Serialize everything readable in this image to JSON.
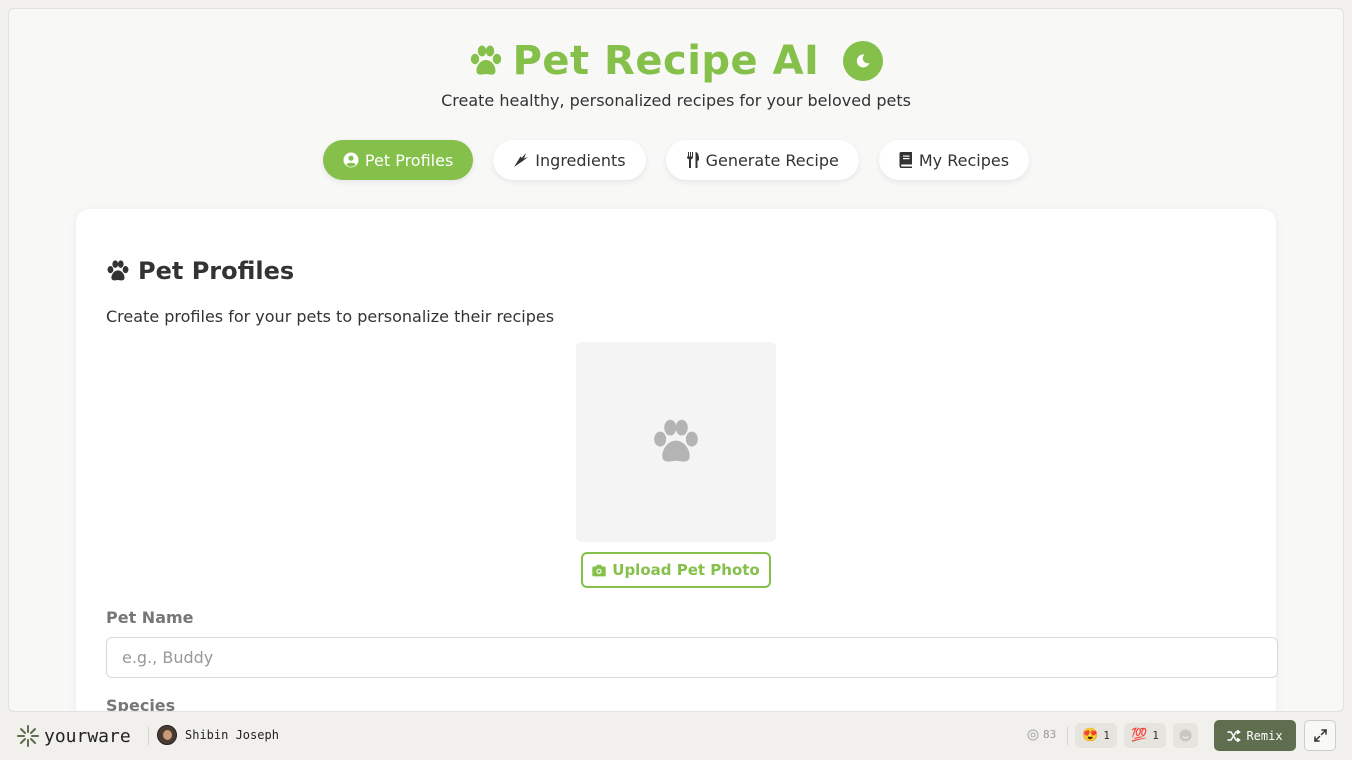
{
  "app": {
    "title": "Pet Recipe AI",
    "subtitle": "Create healthy, personalized recipes for your beloved pets",
    "accent_color": "#84c04a"
  },
  "tabs": [
    {
      "label": "Pet Profiles",
      "icon": "user-circle-icon",
      "active": true
    },
    {
      "label": "Ingredients",
      "icon": "carrot-icon",
      "active": false
    },
    {
      "label": "Generate Recipe",
      "icon": "utensils-icon",
      "active": false
    },
    {
      "label": "My Recipes",
      "icon": "book-icon",
      "active": false
    }
  ],
  "panel": {
    "title": "Pet Profiles",
    "description": "Create profiles for your pets to personalize their recipes",
    "photo_icon": "paw-icon",
    "upload_label": "Upload Pet Photo",
    "fields": {
      "pet_name_label": "Pet Name",
      "pet_name_placeholder": "e.g., Buddy",
      "pet_name_value": "",
      "species_label": "Species"
    }
  },
  "footer": {
    "brand": "yourware",
    "user_name": "Shibin Joseph",
    "views": "83",
    "reactions": [
      {
        "emoji": "😍",
        "count": "1"
      },
      {
        "emoji": "💯",
        "count": "1"
      }
    ],
    "remix_label": "Remix"
  }
}
